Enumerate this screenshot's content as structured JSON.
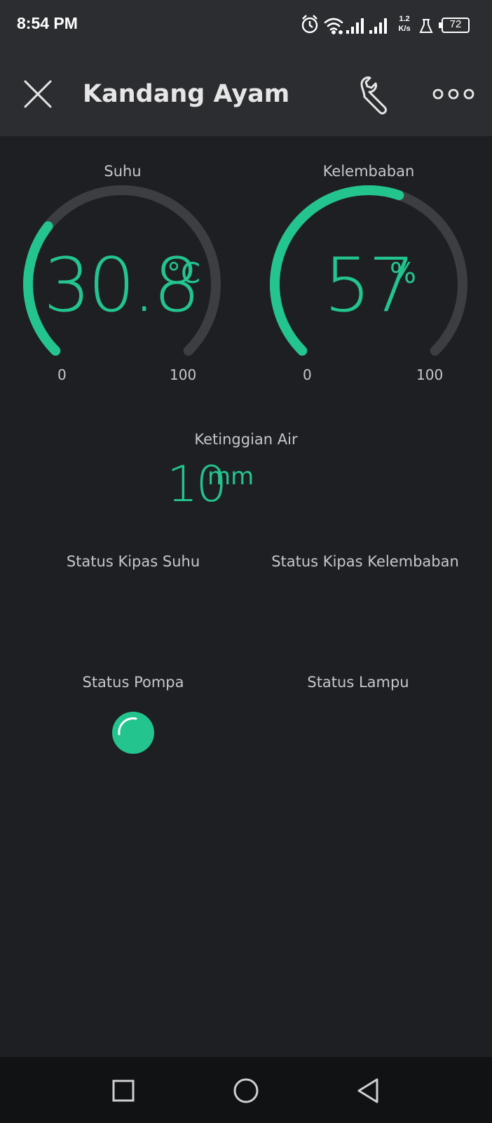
{
  "status_bar": {
    "time": "8:54 PM",
    "speed_value": "1.2",
    "speed_unit": "K/s",
    "battery": "72",
    "icons": [
      "alarm-icon",
      "wifi-icon",
      "signal-icon",
      "signal-icon",
      "flask-icon",
      "battery-icon"
    ]
  },
  "app_bar": {
    "title": "Kandang Ayam",
    "icons": [
      "close-icon",
      "wrench-icon",
      "more-icon"
    ]
  },
  "colors": {
    "accent": "#23c48e",
    "track": "#3d3e42",
    "background": "#1e1f23",
    "bar": "#2c2d31"
  },
  "widgets": {
    "suhu": {
      "label": "Suhu",
      "value": "30.8",
      "unit": "°C",
      "min": "0",
      "max": "100",
      "level": 0.308
    },
    "kelembaban": {
      "label": "Kelembaban",
      "value": "57",
      "unit": "%",
      "min": "0",
      "max": "100",
      "level": 0.57
    },
    "ketinggian_air": {
      "label": "Ketinggian Air",
      "value": "10",
      "unit": "mm"
    },
    "status_kipas_suhu": {
      "label": "Status Kipas Suhu"
    },
    "status_kipas_kelembaban": {
      "label": "Status Kipas Kelembaban"
    },
    "status_pompa": {
      "label": "Status Pompa",
      "on": true
    },
    "status_lampu": {
      "label": "Status Lampu"
    }
  },
  "nav_bar": {
    "icons": [
      "recents-icon",
      "home-icon",
      "back-icon"
    ]
  }
}
